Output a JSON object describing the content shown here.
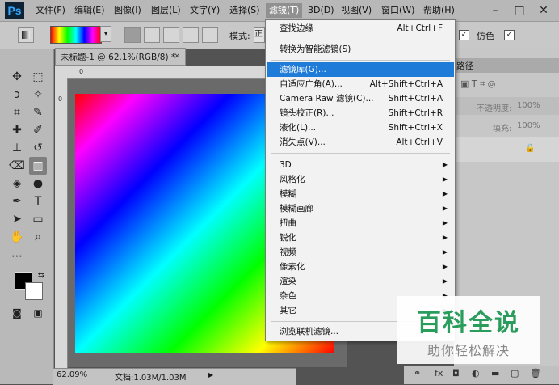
{
  "app_logo": "Ps",
  "menubar": {
    "items": [
      "文件(F)",
      "编辑(E)",
      "图像(I)",
      "图层(L)",
      "文字(Y)",
      "选择(S)",
      "滤镜(T)",
      "3D(D)",
      "视图(V)",
      "窗口(W)",
      "帮助(H)"
    ],
    "active": "滤镜(T)"
  },
  "window_controls": [
    "minimize-icon",
    "maximize-icon",
    "close-icon"
  ],
  "options_bar": {
    "mode_label": "模式:",
    "mode_value": "正",
    "fake_label": "仿色",
    "fake_checked": "✓",
    "transparency_checked": "✓"
  },
  "document": {
    "tab_title": "未标题-1 @ 62.1%(RGB/8) *",
    "close": "×",
    "zoom": "62.09%",
    "doc_size": "文档:1.03M/1.03M",
    "status_arrow": "▶"
  },
  "ruler": {
    "h_zero": "0",
    "v_zero": "0"
  },
  "filter_menu": {
    "group1": [
      {
        "label": "查找边缘",
        "shortcut": "Alt+Ctrl+F"
      }
    ],
    "group2": [
      {
        "label": "转换为智能滤镜(S)",
        "shortcut": ""
      }
    ],
    "group3": [
      {
        "label": "滤镜库(G)...",
        "shortcut": "",
        "highlight": true
      },
      {
        "label": "自适应广角(A)...",
        "shortcut": "Alt+Shift+Ctrl+A"
      },
      {
        "label": "Camera Raw 滤镜(C)...",
        "shortcut": "Shift+Ctrl+A"
      },
      {
        "label": "镜头校正(R)...",
        "shortcut": "Shift+Ctrl+R"
      },
      {
        "label": "液化(L)...",
        "shortcut": "Shift+Ctrl+X"
      },
      {
        "label": "消失点(V)...",
        "shortcut": "Alt+Ctrl+V"
      }
    ],
    "group4": [
      {
        "label": "3D",
        "submenu": true
      },
      {
        "label": "风格化",
        "submenu": true
      },
      {
        "label": "模糊",
        "submenu": true
      },
      {
        "label": "模糊画廊",
        "submenu": true
      },
      {
        "label": "扭曲",
        "submenu": true
      },
      {
        "label": "锐化",
        "submenu": true
      },
      {
        "label": "视频",
        "submenu": true
      },
      {
        "label": "像素化",
        "submenu": true
      },
      {
        "label": "渲染",
        "submenu": true
      },
      {
        "label": "杂色",
        "submenu": true
      },
      {
        "label": "其它",
        "submenu": true
      }
    ],
    "group5": [
      {
        "label": "浏览联机滤镜...",
        "shortcut": ""
      }
    ],
    "submenu_arrow": "▶"
  },
  "right_panel": {
    "paths_tab": "路径",
    "opacity_label": "不透明度:",
    "opacity_value": "100%",
    "fill_label": "填充:",
    "fill_value": "100%"
  },
  "watermark": {
    "title": "百科全说",
    "subtitle": "助你轻松解决"
  }
}
